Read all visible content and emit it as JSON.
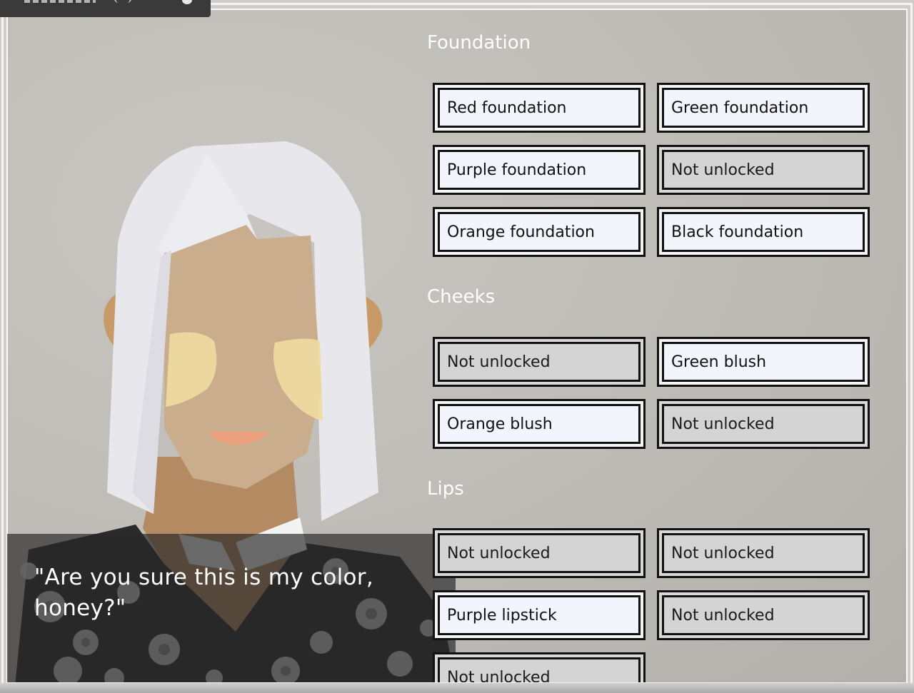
{
  "dialogue": {
    "line1": "\"Are you sure this is my color,",
    "line2": "honey?\""
  },
  "sections": {
    "foundation": {
      "title": "Foundation",
      "options": [
        {
          "label": "Red foundation",
          "locked": false
        },
        {
          "label": "Green foundation",
          "locked": false
        },
        {
          "label": "Purple foundation",
          "locked": false
        },
        {
          "label": "Not unlocked",
          "locked": true
        },
        {
          "label": "Orange foundation",
          "locked": false
        },
        {
          "label": "Black foundation",
          "locked": false
        }
      ]
    },
    "cheeks": {
      "title": "Cheeks",
      "options": [
        {
          "label": "Not unlocked",
          "locked": true
        },
        {
          "label": "Green blush",
          "locked": false
        },
        {
          "label": "Orange blush",
          "locked": false
        },
        {
          "label": "Not unlocked",
          "locked": true
        }
      ]
    },
    "lips": {
      "title": "Lips",
      "options": [
        {
          "label": "Not unlocked",
          "locked": true
        },
        {
          "label": "Not unlocked",
          "locked": true
        },
        {
          "label": "Purple lipstick",
          "locked": false
        },
        {
          "label": "Not unlocked",
          "locked": true
        },
        {
          "label": "Not unlocked",
          "locked": true
        }
      ]
    }
  },
  "colors": {
    "button_unlocked": "#f3f5fd",
    "button_locked": "#d4d4d4",
    "section_title": "#ffffff",
    "dialogue_bg": "#282828"
  }
}
